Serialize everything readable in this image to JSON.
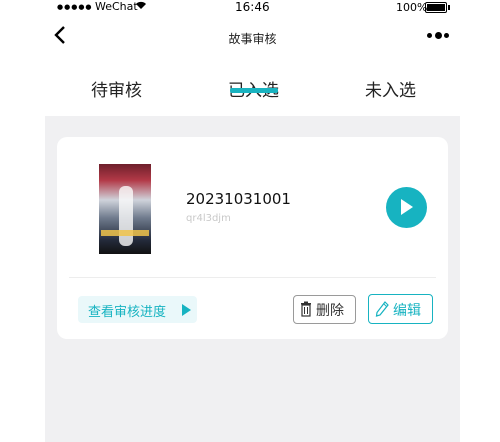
{
  "status_bar": {
    "signal_dots": "●●●●●",
    "carrier": "WeChat",
    "time": "16:46",
    "battery": "100%"
  },
  "nav": {
    "title": "故事审核",
    "back_icon": "chevron-left-icon",
    "more_icon": "more-dots-icon"
  },
  "tabs": [
    {
      "label": "待审核",
      "active": false
    },
    {
      "label": "已入选",
      "active": true
    },
    {
      "label": "未入选",
      "active": false
    }
  ],
  "story": {
    "id": "20231031001",
    "subtitle": "qr4l3djm",
    "cover_icon": "story-cover-image"
  },
  "actions": {
    "progress_label": "查看审核进度",
    "delete_label": "删除",
    "edit_label": "编辑"
  },
  "colors": {
    "accent": "#17b3c1",
    "background": "#f0f0f2"
  }
}
